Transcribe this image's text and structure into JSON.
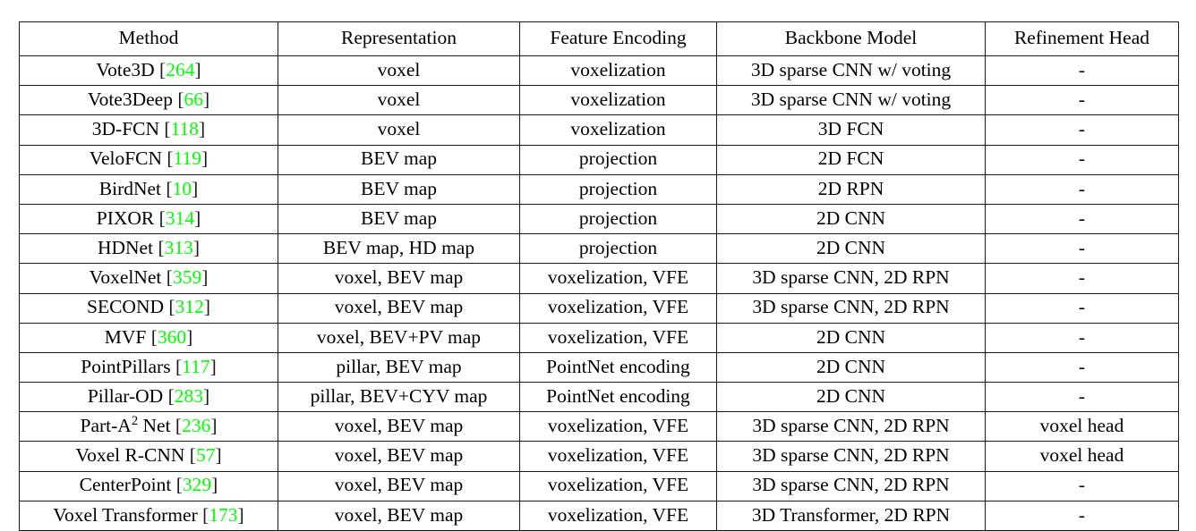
{
  "table": {
    "columns": [
      "Method",
      "Representation",
      "Feature Encoding",
      "Backbone Model",
      "Refinement Head"
    ],
    "citation_color": "#00ff00",
    "rule_color": "#1a1a1a",
    "rows": [
      {
        "method_name": "Vote3D",
        "method_ref": "264",
        "representation": "voxel",
        "feature_encoding": "voxelization",
        "backbone_model": "3D sparse CNN w/ voting",
        "refinement_head": "-"
      },
      {
        "method_name": "Vote3Deep",
        "method_ref": "66",
        "representation": "voxel",
        "feature_encoding": "voxelization",
        "backbone_model": "3D sparse CNN w/ voting",
        "refinement_head": "-"
      },
      {
        "method_name": "3D-FCN",
        "method_ref": "118",
        "representation": "voxel",
        "feature_encoding": "voxelization",
        "backbone_model": "3D FCN",
        "refinement_head": "-"
      },
      {
        "method_name": "VeloFCN",
        "method_ref": "119",
        "representation": "BEV map",
        "feature_encoding": "projection",
        "backbone_model": "2D FCN",
        "refinement_head": "-"
      },
      {
        "method_name": "BirdNet",
        "method_ref": "10",
        "representation": "BEV map",
        "feature_encoding": "projection",
        "backbone_model": "2D RPN",
        "refinement_head": "-"
      },
      {
        "method_name": "PIXOR",
        "method_ref": "314",
        "representation": "BEV map",
        "feature_encoding": "projection",
        "backbone_model": "2D CNN",
        "refinement_head": "-"
      },
      {
        "method_name": "HDNet",
        "method_ref": "313",
        "representation": "BEV map, HD map",
        "feature_encoding": "projection",
        "backbone_model": "2D CNN",
        "refinement_head": "-"
      },
      {
        "method_name": "VoxelNet",
        "method_ref": "359",
        "representation": "voxel, BEV map",
        "feature_encoding": "voxelization, VFE",
        "backbone_model": "3D sparse CNN, 2D RPN",
        "refinement_head": "-"
      },
      {
        "method_name": "SECOND",
        "method_ref": "312",
        "representation": "voxel, BEV map",
        "feature_encoding": "voxelization, VFE",
        "backbone_model": "3D sparse CNN, 2D RPN",
        "refinement_head": "-"
      },
      {
        "method_name": "MVF",
        "method_ref": "360",
        "representation": "voxel, BEV+PV map",
        "feature_encoding": "voxelization, VFE",
        "backbone_model": "2D CNN",
        "refinement_head": "-"
      },
      {
        "method_name": "PointPillars",
        "method_ref": "117",
        "representation": "pillar, BEV map",
        "feature_encoding": "PointNet encoding",
        "backbone_model": "2D CNN",
        "refinement_head": "-"
      },
      {
        "method_name": "Pillar-OD",
        "method_ref": "283",
        "representation": "pillar, BEV+CYV map",
        "feature_encoding": "PointNet encoding",
        "backbone_model": "2D CNN",
        "refinement_head": "-"
      },
      {
        "method_name": "Part-A",
        "method_sup": "2",
        "method_name_tail": " Net",
        "method_ref": "236",
        "representation": "voxel, BEV map",
        "feature_encoding": "voxelization, VFE",
        "backbone_model": "3D sparse CNN, 2D RPN",
        "refinement_head": "voxel head"
      },
      {
        "method_name": "Voxel R-CNN",
        "method_ref": "57",
        "representation": "voxel, BEV map",
        "feature_encoding": "voxelization, VFE",
        "backbone_model": "3D sparse CNN, 2D RPN",
        "refinement_head": "voxel head"
      },
      {
        "method_name": "CenterPoint",
        "method_ref": "329",
        "representation": "voxel, BEV map",
        "feature_encoding": "voxelization, VFE",
        "backbone_model": "3D sparse CNN, 2D RPN",
        "refinement_head": "-"
      },
      {
        "method_name": "Voxel Transformer",
        "method_ref": "173",
        "representation": "voxel, BEV map",
        "feature_encoding": "voxelization, VFE",
        "backbone_model": "3D Transformer, 2D RPN",
        "refinement_head": "-"
      }
    ]
  }
}
